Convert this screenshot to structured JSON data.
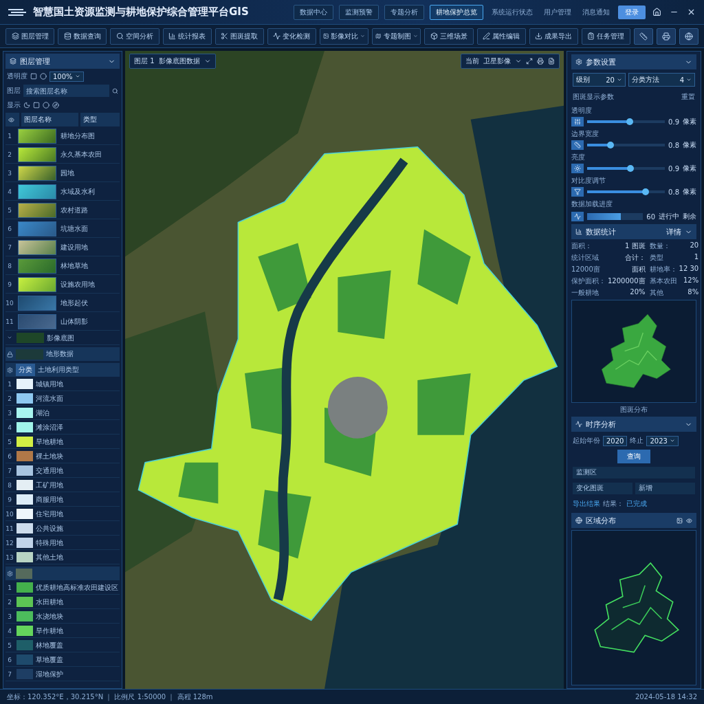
{
  "header": {
    "title": "智慧国土资源监测与耕地保护综合管理平台GIS",
    "nav": [
      {
        "label": "数据中心",
        "selected": false
      },
      {
        "label": "监测预警",
        "selected": false
      },
      {
        "label": "专题分析",
        "selected": false
      },
      {
        "label": "耕地保护总览",
        "selected": true
      }
    ],
    "links": [
      "系统运行状态",
      "用户管理",
      "消息通知"
    ],
    "action": "登录"
  },
  "toolbar": [
    {
      "label": "图层管理",
      "dropdown": false
    },
    {
      "label": "数据查询",
      "dropdown": false
    },
    {
      "label": "空间分析",
      "dropdown": false
    },
    {
      "label": "统计报表",
      "dropdown": false
    },
    {
      "label": "图斑提取",
      "dropdown": false
    },
    {
      "label": "变化检测",
      "dropdown": false
    },
    {
      "label": "影像对比",
      "dropdown": true
    },
    {
      "label": "专题制图",
      "dropdown": true
    },
    {
      "label": "三维场景",
      "dropdown": false
    },
    {
      "label": "属性编辑",
      "dropdown": false
    },
    {
      "label": "成果导出",
      "dropdown": false
    },
    {
      "label": "任务管理",
      "dropdown": false
    }
  ],
  "left": {
    "title": "图层管理",
    "opacity_label": "透明度",
    "opacity_value": "100%",
    "search_label": "图层",
    "search_placeholder": "搜索图层名称",
    "view_label": "显示",
    "columns": [
      "图层名称",
      "类型"
    ],
    "layers": [
      {
        "index": "1",
        "name": "耕地分布图"
      },
      {
        "index": "2",
        "name": "永久基本农田"
      },
      {
        "index": "3",
        "name": "园地"
      },
      {
        "index": "4",
        "name": "水域及水利"
      },
      {
        "index": "5",
        "name": "农村道路"
      },
      {
        "index": "6",
        "name": "坑塘水面"
      },
      {
        "index": "7",
        "name": "建设用地"
      },
      {
        "index": "8",
        "name": "林地草地"
      },
      {
        "index": "9",
        "name": "设施农用地"
      },
      {
        "index": "10",
        "name": "地形起伏"
      },
      {
        "index": "11",
        "name": "山体阴影"
      }
    ],
    "basemap": "影像底图",
    "terrain": "地形数据",
    "groups": [
      {
        "badge": "分类",
        "title": "土地利用类型",
        "items": [
          {
            "index": "1",
            "name": "城镇用地",
            "color": "#e6f2fb"
          },
          {
            "index": "2",
            "name": "河流水面",
            "color": "#8ec8f0"
          },
          {
            "index": "3",
            "name": "湖泊",
            "color": "#a8f5f0"
          },
          {
            "index": "4",
            "name": "滩涂沼泽",
            "color": "#a0f5ea"
          },
          {
            "index": "5",
            "name": "旱地耕地",
            "color": "#d2ee44"
          },
          {
            "index": "6",
            "name": "裸土地块",
            "color": "#b07848"
          },
          {
            "index": "7",
            "name": "交通用地",
            "color": "#a8c4e0"
          },
          {
            "index": "8",
            "name": "工矿用地",
            "color": "#e4eef4"
          },
          {
            "index": "9",
            "name": "商服用地",
            "color": "#dcecf8"
          },
          {
            "index": "10",
            "name": "住宅用地",
            "color": "#eef6fc"
          },
          {
            "index": "11",
            "name": "公共设施",
            "color": "#ccdcec"
          },
          {
            "index": "12",
            "name": "特殊用地",
            "color": "#c0d4ea"
          },
          {
            "index": "13",
            "name": "其他土地",
            "color": "#b8d4c4"
          }
        ]
      },
      {
        "items": [
          {
            "index": "1",
            "name": "优质耕地高标准农田建设区",
            "color": "#44b04c"
          },
          {
            "index": "2",
            "name": "水田耕地",
            "color": "#5cc454"
          },
          {
            "index": "3",
            "name": "水浇地块",
            "color": "#4cbc5c"
          },
          {
            "index": "4",
            "name": "旱作耕地",
            "color": "#64d45c"
          },
          {
            "index": "5",
            "name": "林地覆盖",
            "color": "#1e5e68"
          },
          {
            "index": "6",
            "name": "草地覆盖",
            "color": "#1e4a6c"
          },
          {
            "index": "7",
            "name": "湿地保护",
            "color": "#1e3e64"
          }
        ]
      }
    ]
  },
  "map": {
    "layer_label": "图层 1",
    "layer_value": "影像底图数据",
    "view_label": "当前",
    "view_value": "卫星影像"
  },
  "right": {
    "params": {
      "title": "参数设置",
      "select_a": {
        "label": "级别",
        "value": "20"
      },
      "select_b": {
        "label": "分类方法",
        "value": "4"
      },
      "section": "图斑显示参数",
      "reset": "重置",
      "sliders": [
        {
          "caption": "透明度",
          "level": 0.55,
          "reading": "0.9",
          "unit": "像素"
        },
        {
          "caption": "边界宽度",
          "level": 0.3,
          "reading": "0.8",
          "unit": "像素"
        },
        {
          "caption": "亮度",
          "level": 0.56,
          "reading": "0.9",
          "unit": "像素"
        },
        {
          "caption": "对比度调节",
          "level": 0.75,
          "reading": "0.8",
          "unit": "像素"
        }
      ],
      "progress_label": "数据加载进度",
      "progress": {
        "caption": "60",
        "level": 0.6,
        "reading": "进行中",
        "unit": "剩余"
      }
    },
    "stats": {
      "title": "数据统计",
      "extra": "详情",
      "items": [
        {
          "label": "面积：",
          "value": "1 图斑"
        },
        {
          "label": "数量：",
          "value": "20"
        },
        {
          "label": "统计区域",
          "value": "合计："
        },
        {
          "label": "类型",
          "value": "1"
        },
        {
          "label": "12000亩",
          "value": "面积"
        },
        {
          "label": "耕地率：",
          "value": "12 30"
        },
        {
          "label": "保护面积：",
          "value": "1200000亩"
        },
        {
          "label": "基本农田",
          "value": "12%"
        },
        {
          "label": "一般耕地",
          "value": "20%"
        },
        {
          "label": "其他",
          "value": "8%"
        }
      ],
      "map_caption": "图斑分布"
    },
    "timeline": {
      "title": "时序分析",
      "from_label": "起始年份",
      "from_value": "2020",
      "to_label": "终止",
      "to_value": "2023",
      "button": "查询",
      "field_a": "监测区",
      "field_b": "变化图斑",
      "field_c": "新增",
      "link": "导出结果",
      "result_label": "结果：",
      "result_value": "已完成"
    },
    "legend": {
      "title": "区域分布"
    }
  },
  "status": {
    "left": "坐标：120.352°E，30.215°N ｜ 比例尺 1:50000 ｜ 高程 128m",
    "right": "2024-05-18 14:32"
  }
}
